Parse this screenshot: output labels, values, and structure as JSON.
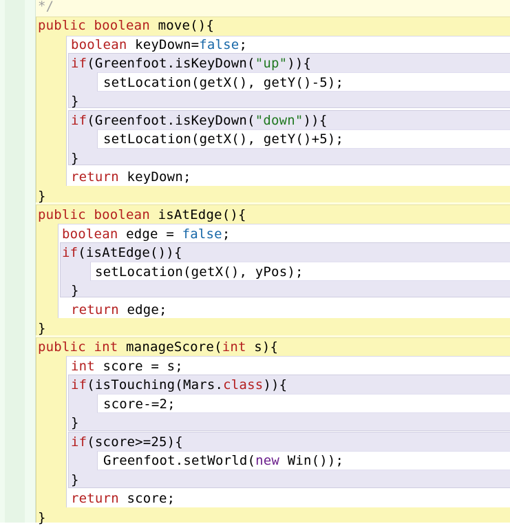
{
  "editor": {
    "lines": [
      {
        "name": "comment-end-line",
        "tokens": [
          {
            "t": "*/",
            "c": "cmt"
          }
        ]
      },
      {
        "name": "move-signature",
        "tokens": [
          {
            "t": "public",
            "c": "kw"
          },
          {
            "t": " "
          },
          {
            "t": "boolean",
            "c": "kw"
          },
          {
            "t": " move(){"
          }
        ]
      },
      {
        "name": "keydown-declaration",
        "tokens": [
          {
            "t": "boolean",
            "c": "kw"
          },
          {
            "t": " keyDown="
          },
          {
            "t": "false",
            "c": "val"
          },
          {
            "t": ";"
          }
        ]
      },
      {
        "name": "if-up-line",
        "tokens": [
          {
            "t": "if",
            "c": "kw"
          },
          {
            "t": "(Greenfoot.isKeyDown("
          },
          {
            "t": "\"up\"",
            "c": "str"
          },
          {
            "t": ")){"
          }
        ]
      },
      {
        "name": "set-location-up",
        "tokens": [
          {
            "t": "setLocation(getX(), getY()-5);"
          }
        ]
      },
      {
        "name": "close-if-up",
        "tokens": [
          {
            "t": "}"
          }
        ]
      },
      {
        "name": "if-down-line",
        "tokens": [
          {
            "t": "if",
            "c": "kw"
          },
          {
            "t": "(Greenfoot.isKeyDown("
          },
          {
            "t": "\"down\"",
            "c": "str"
          },
          {
            "t": ")){"
          }
        ]
      },
      {
        "name": "set-location-down",
        "tokens": [
          {
            "t": "setLocation(getX(), getY()+5);"
          }
        ]
      },
      {
        "name": "close-if-down",
        "tokens": [
          {
            "t": "}"
          }
        ]
      },
      {
        "name": "return-keydown",
        "tokens": [
          {
            "t": "return",
            "c": "kw"
          },
          {
            "t": " keyDown;"
          }
        ]
      },
      {
        "name": "close-move",
        "tokens": [
          {
            "t": "}"
          }
        ]
      },
      {
        "name": "isatedge-signature",
        "tokens": [
          {
            "t": "public",
            "c": "kw"
          },
          {
            "t": " "
          },
          {
            "t": "boolean",
            "c": "kw"
          },
          {
            "t": " isAtEdge(){"
          }
        ]
      },
      {
        "name": "edge-declaration",
        "tokens": [
          {
            "t": "boolean",
            "c": "kw"
          },
          {
            "t": " edge = "
          },
          {
            "t": "false",
            "c": "val"
          },
          {
            "t": ";"
          }
        ]
      },
      {
        "name": "if-isatedge-line",
        "tokens": [
          {
            "t": "if",
            "c": "kw"
          },
          {
            "t": "(isAtEdge()){"
          }
        ]
      },
      {
        "name": "set-location-ypos",
        "tokens": [
          {
            "t": "setLocation(getX(), yPos);"
          }
        ]
      },
      {
        "name": "close-if-isatedge",
        "tokens": [
          {
            "t": "}"
          }
        ]
      },
      {
        "name": "return-edge",
        "tokens": [
          {
            "t": "return",
            "c": "kw"
          },
          {
            "t": " edge;"
          }
        ]
      },
      {
        "name": "close-isatedge",
        "tokens": [
          {
            "t": "}"
          }
        ]
      },
      {
        "name": "managescore-signature",
        "tokens": [
          {
            "t": "public",
            "c": "kw"
          },
          {
            "t": " "
          },
          {
            "t": "int",
            "c": "kw"
          },
          {
            "t": " manageScore("
          },
          {
            "t": "int",
            "c": "kw"
          },
          {
            "t": " s){"
          }
        ]
      },
      {
        "name": "score-declaration",
        "tokens": [
          {
            "t": "int",
            "c": "kw"
          },
          {
            "t": " score = s;"
          }
        ]
      },
      {
        "name": "if-istouching-line",
        "tokens": [
          {
            "t": "if",
            "c": "kw"
          },
          {
            "t": "(isTouching(Mars."
          },
          {
            "t": "class",
            "c": "kw"
          },
          {
            "t": ")){"
          }
        ]
      },
      {
        "name": "score-decrement",
        "tokens": [
          {
            "t": "score-=2;"
          }
        ]
      },
      {
        "name": "close-if-istouching",
        "tokens": [
          {
            "t": "}"
          }
        ]
      },
      {
        "name": "if-score-line",
        "tokens": [
          {
            "t": "if",
            "c": "kw"
          },
          {
            "t": "(score>=25){"
          }
        ]
      },
      {
        "name": "set-world-line",
        "tokens": [
          {
            "t": "Greenfoot.setWorld("
          },
          {
            "t": "new",
            "c": "new"
          },
          {
            "t": " Win());"
          }
        ]
      },
      {
        "name": "close-if-score",
        "tokens": [
          {
            "t": "}"
          }
        ]
      },
      {
        "name": "return-score",
        "tokens": [
          {
            "t": "return",
            "c": "kw"
          },
          {
            "t": " score;"
          }
        ]
      },
      {
        "name": "close-managescore",
        "tokens": [
          {
            "t": "}"
          }
        ]
      }
    ]
  }
}
